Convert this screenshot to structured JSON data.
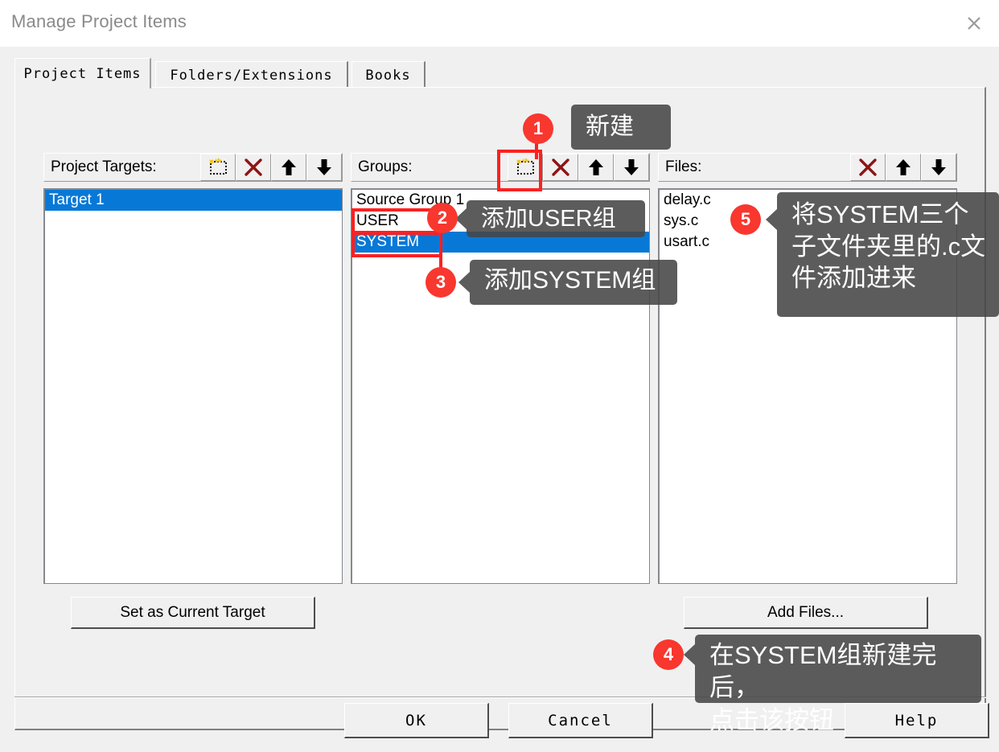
{
  "window": {
    "title": "Manage Project Items",
    "close_icon": "close-icon"
  },
  "tabs": [
    {
      "label": "Project Items",
      "active": true
    },
    {
      "label": "Folders/Extensions",
      "active": false
    },
    {
      "label": "Books",
      "active": false
    }
  ],
  "columns": {
    "targets": {
      "label": "Project Targets:",
      "toolbar": [
        "new-icon",
        "delete-icon",
        "move-up-icon",
        "move-down-icon"
      ],
      "items": [
        {
          "label": "Target 1",
          "selected": true
        }
      ],
      "action_button": "Set as Current Target"
    },
    "groups": {
      "label": "Groups:",
      "toolbar": [
        "new-icon",
        "delete-icon",
        "move-up-icon",
        "move-down-icon"
      ],
      "items": [
        {
          "label": "Source Group 1",
          "selected": false
        },
        {
          "label": "USER",
          "selected": false
        },
        {
          "label": "SYSTEM",
          "selected": true
        }
      ]
    },
    "files": {
      "label": "Files:",
      "toolbar": [
        "delete-icon",
        "move-up-icon",
        "move-down-icon"
      ],
      "items": [
        {
          "label": "delay.c",
          "selected": false
        },
        {
          "label": "sys.c",
          "selected": false
        },
        {
          "label": "usart.c",
          "selected": false
        }
      ],
      "action_button": "Add Files..."
    }
  },
  "dialog_buttons": {
    "ok": "OK",
    "cancel": "Cancel",
    "help": "Help"
  },
  "annotations": {
    "accent_color": "#f8372f",
    "tooltip_color": "#464646",
    "items": [
      {
        "number": "1",
        "text": "新建"
      },
      {
        "number": "2",
        "text": "添加USER组"
      },
      {
        "number": "3",
        "text": "添加SYSTEM组"
      },
      {
        "number": "4",
        "text": "在SYSTEM组新建完后，\n点击该按钮"
      },
      {
        "number": "5",
        "text": "将SYSTEM三个\n子文件夹里的.c文\n件添加进来"
      }
    ]
  }
}
